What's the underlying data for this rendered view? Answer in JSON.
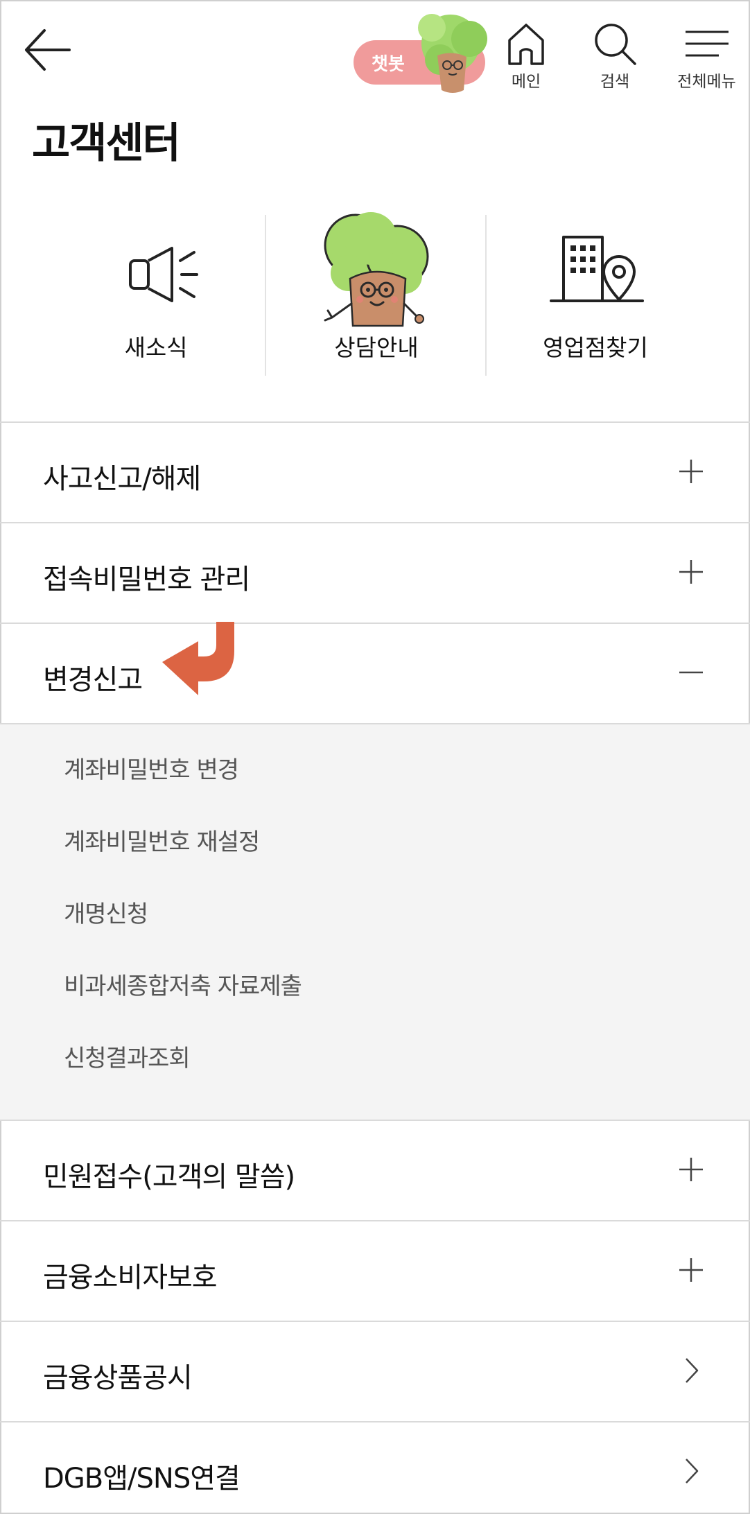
{
  "header": {
    "chatbot_label": "챗봇",
    "nav": {
      "main_label": "메인",
      "search_label": "검색",
      "menu_label": "전체메뉴"
    }
  },
  "page_title": "고객센터",
  "quick_menu": [
    {
      "label": "새소식",
      "icon": "megaphone-icon"
    },
    {
      "label": "상담안내",
      "icon": "tree-mascot-icon"
    },
    {
      "label": "영업점찾기",
      "icon": "building-location-icon"
    }
  ],
  "accordion": {
    "items_before": [
      {
        "label": "사고신고/해제",
        "icon": "plus-icon"
      },
      {
        "label": "접속비밀번호 관리",
        "icon": "plus-icon"
      }
    ],
    "expanded": {
      "label": "변경신고",
      "icon": "minus-icon",
      "sub_items": [
        "계좌비밀번호 변경",
        "계좌비밀번호 재설정",
        "개명신청",
        "비과세종합저축 자료제출",
        "신청결과조회"
      ]
    },
    "items_after": [
      {
        "label": "민원접수(고객의 말씀)",
        "icon": "plus-icon"
      },
      {
        "label": "금융소비자보호",
        "icon": "plus-icon"
      },
      {
        "label": "금융상품공시",
        "icon": "chevron-right-icon"
      },
      {
        "label": "DGB앱/SNS연결",
        "icon": "chevron-right-icon"
      }
    ]
  },
  "colors": {
    "chatbot_bg": "#f09b9b",
    "annotation_arrow": "#dc6443",
    "sub_panel_bg": "#f4f4f4",
    "mascot_green": "#9fd86a"
  }
}
